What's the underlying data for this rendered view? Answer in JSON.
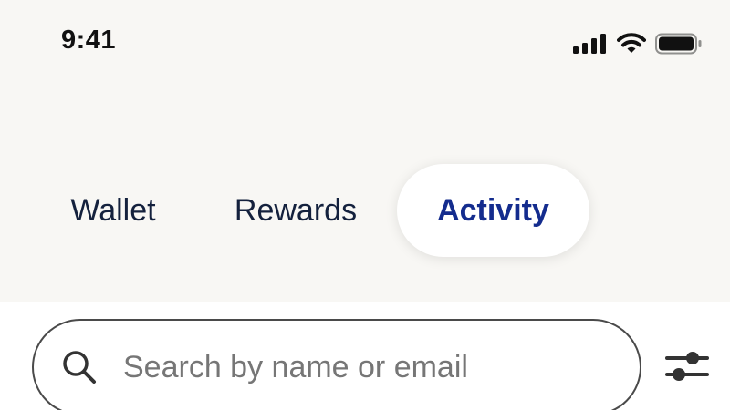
{
  "status_bar": {
    "time": "9:41",
    "icons": [
      "cellular-signal-icon",
      "wifi-icon",
      "battery-icon"
    ]
  },
  "tabs": [
    {
      "label": "Wallet",
      "selected": false
    },
    {
      "label": "Rewards",
      "selected": false
    },
    {
      "label": "Activity",
      "selected": true
    }
  ],
  "search": {
    "value": "",
    "placeholder": "Search by name or email",
    "icon": "search-icon"
  },
  "filter": {
    "icon": "sliders-icon"
  },
  "colors": {
    "background_top": "#f8f7f4",
    "text_primary": "#14213d",
    "accent": "#142c8e",
    "border": "#4a4a4a",
    "placeholder": "#767676"
  }
}
